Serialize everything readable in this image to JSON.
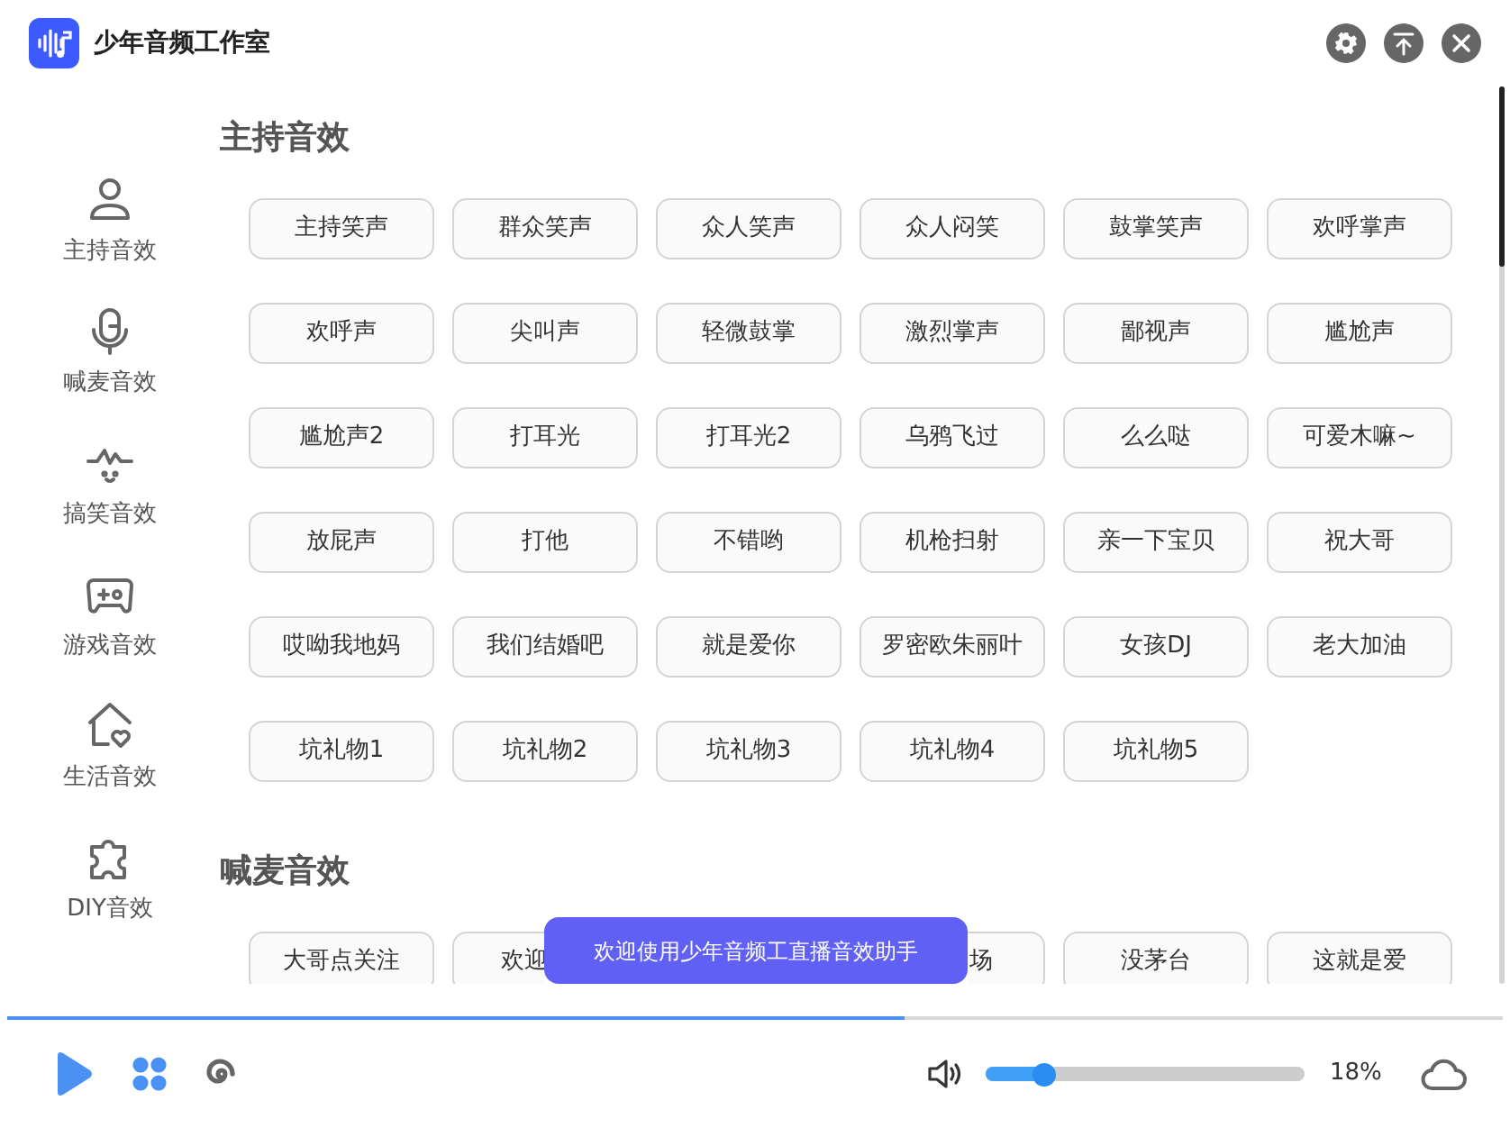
{
  "window": {
    "title": "少年音频工作室"
  },
  "sidebar": {
    "items": [
      {
        "label": "主持音效",
        "kind": "person"
      },
      {
        "label": "喊麦音效",
        "kind": "mic"
      },
      {
        "label": "搞笑音效",
        "kind": "funny"
      },
      {
        "label": "游戏音效",
        "kind": "game"
      },
      {
        "label": "生活音效",
        "kind": "home"
      },
      {
        "label": "DIY音效",
        "kind": "puzzle"
      }
    ]
  },
  "sections": [
    {
      "title": "主持音效",
      "buttons": [
        {
          "label": "主持笑声"
        },
        {
          "label": "群众笑声"
        },
        {
          "label": "众人笑声"
        },
        {
          "label": "众人闷笑"
        },
        {
          "label": "鼓掌笑声"
        },
        {
          "label": "欢呼掌声"
        },
        {
          "label": "欢呼声"
        },
        {
          "label": "尖叫声"
        },
        {
          "label": "轻微鼓掌"
        },
        {
          "label": "激烈掌声"
        },
        {
          "label": "鄙视声"
        },
        {
          "label": "尴尬声"
        },
        {
          "label": "尴尬声2"
        },
        {
          "label": "打耳光"
        },
        {
          "label": "打耳光2"
        },
        {
          "label": "乌鸦飞过"
        },
        {
          "label": "么么哒"
        },
        {
          "label": "可爱木嘛~"
        },
        {
          "label": "放屁声"
        },
        {
          "label": "打他"
        },
        {
          "label": "不错哟"
        },
        {
          "label": "机枪扫射"
        },
        {
          "label": "亲一下宝贝"
        },
        {
          "label": "祝大哥"
        },
        {
          "label": "哎呦我地妈"
        },
        {
          "label": "我们结婚吧"
        },
        {
          "label": "就是爱你"
        },
        {
          "label": "罗密欧朱丽叶"
        },
        {
          "label": "女孩DJ"
        },
        {
          "label": "老大加油"
        },
        {
          "label": "坑礼物1"
        },
        {
          "label": "坑礼物2"
        },
        {
          "label": "坑礼物3"
        },
        {
          "label": "坑礼物4"
        },
        {
          "label": "坑礼物5"
        }
      ]
    },
    {
      "title": "喊麦音效",
      "buttons": [
        {
          "label": "大哥点关注",
          "kind": "whole"
        },
        {
          "label": "欢迎",
          "kind": "cut-end"
        },
        {
          "label": "场",
          "kind": "cut-start"
        },
        {
          "label": "没茅台",
          "kind": "whole"
        },
        {
          "label": "这就是爱",
          "kind": "whole"
        }
      ]
    }
  ],
  "toast": {
    "text": "欢迎使用少年音频工直播音效助手"
  },
  "player": {
    "progress": {
      "level": 0.6
    },
    "volume": {
      "level": 0.18,
      "reading": "18%"
    }
  }
}
